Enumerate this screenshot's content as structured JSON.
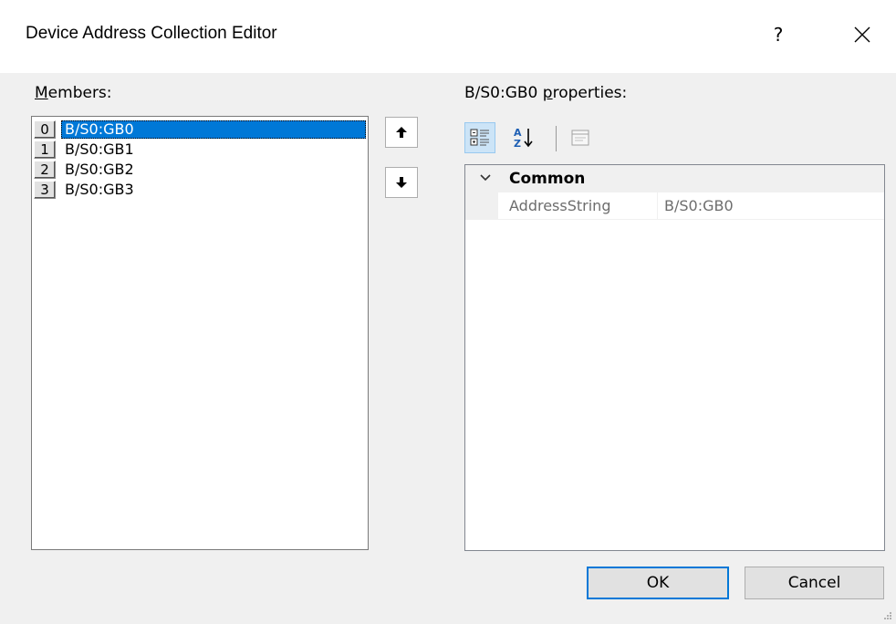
{
  "window": {
    "title": "Device Address Collection Editor",
    "help_glyph": "?",
    "close_glyph": "✕"
  },
  "members": {
    "label_mnemonic": "M",
    "label_rest": "embers:",
    "items": [
      {
        "index": "0",
        "name": "B/S0:GB0",
        "selected": true
      },
      {
        "index": "1",
        "name": "B/S0:GB1",
        "selected": false
      },
      {
        "index": "2",
        "name": "B/S0:GB2",
        "selected": false
      },
      {
        "index": "3",
        "name": "B/S0:GB3",
        "selected": false
      }
    ]
  },
  "move_buttons": {
    "up_icon": "arrow-up-icon",
    "down_icon": "arrow-down-icon"
  },
  "properties": {
    "label_prefix": "B/S0:GB0 ",
    "label_mnemonic": "p",
    "label_rest": "roperties:",
    "toolbar": {
      "categorized_icon": "categorized-icon",
      "alphabetical_icon": "sort-alphabetical-icon",
      "property_pages_icon": "property-pages-icon"
    },
    "category": "Common",
    "rows": [
      {
        "name": "AddressString",
        "value": "B/S0:GB0"
      }
    ]
  },
  "buttons": {
    "ok": "OK",
    "cancel": "Cancel"
  },
  "colors": {
    "selection": "#0078d7",
    "dialog_bg": "#f0f0f0",
    "default_button_border": "#0078d7"
  }
}
